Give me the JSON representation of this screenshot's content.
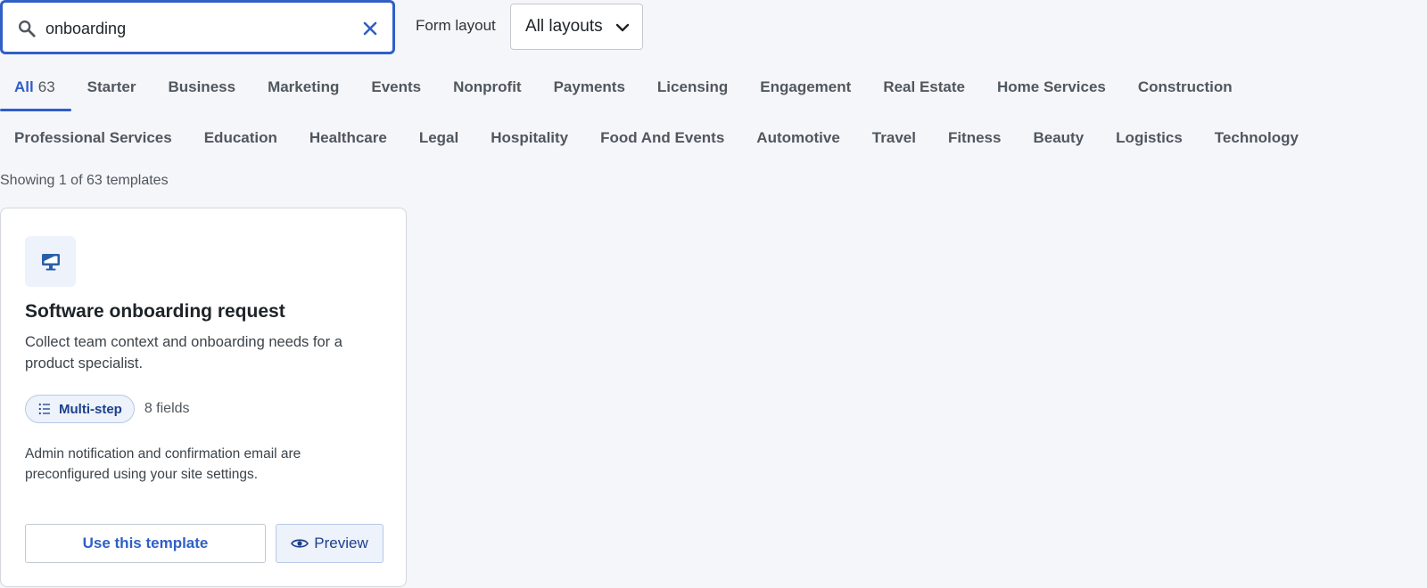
{
  "search": {
    "value": "onboarding",
    "icon": "search-icon",
    "clear_icon": "close-icon"
  },
  "layout_filter": {
    "label": "Form layout",
    "selected": "All layouts",
    "icon": "chevron-down-icon"
  },
  "tabs_row1": [
    {
      "label": "All",
      "count": "63",
      "active": true
    },
    {
      "label": "Starter"
    },
    {
      "label": "Business"
    },
    {
      "label": "Marketing"
    },
    {
      "label": "Events"
    },
    {
      "label": "Nonprofit"
    },
    {
      "label": "Payments"
    },
    {
      "label": "Licensing"
    },
    {
      "label": "Engagement"
    },
    {
      "label": "Real Estate"
    },
    {
      "label": "Home Services"
    },
    {
      "label": "Construction"
    }
  ],
  "tabs_row2": [
    {
      "label": "Professional Services"
    },
    {
      "label": "Education"
    },
    {
      "label": "Healthcare"
    },
    {
      "label": "Legal"
    },
    {
      "label": "Hospitality"
    },
    {
      "label": "Food And Events"
    },
    {
      "label": "Automotive"
    },
    {
      "label": "Travel"
    },
    {
      "label": "Fitness"
    },
    {
      "label": "Beauty"
    },
    {
      "label": "Logistics"
    },
    {
      "label": "Technology"
    }
  ],
  "results": {
    "showing_text": "Showing 1 of 63 templates"
  },
  "card": {
    "icon": "monitor-icon",
    "title": "Software onboarding request",
    "description": "Collect team context and onboarding needs for a product specialist.",
    "badge": "Multi-step",
    "badge_icon": "list-icon",
    "fields": "8 fields",
    "note": "Admin notification and confirmation email are preconfigured using your site settings.",
    "use_button": "Use this template",
    "preview_button": "Preview",
    "preview_icon": "eye-icon"
  },
  "colors": {
    "accent": "#2f5fc7",
    "background": "#f5f6fa",
    "chip_bg": "#edf2fb",
    "chip_text": "#1e3f8a"
  }
}
